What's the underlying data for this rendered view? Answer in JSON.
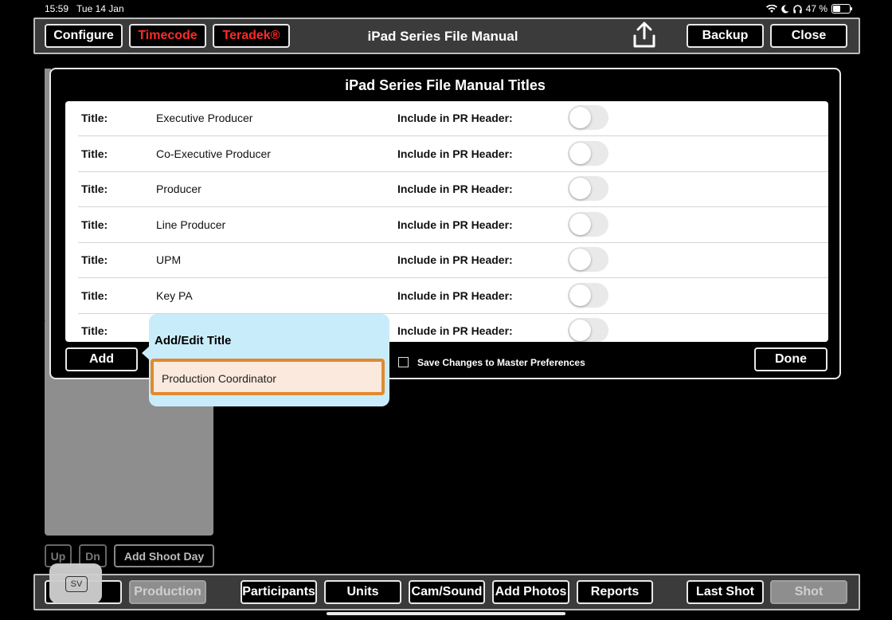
{
  "status": {
    "time": "15:59",
    "date": "Tue 14 Jan",
    "battery": "47 %"
  },
  "topbar": {
    "configure": "Configure",
    "timecode": "Timecode",
    "teradek": "Teradek®",
    "title": "iPad Series File Manual",
    "backup": "Backup",
    "close": "Close"
  },
  "modal": {
    "title": "iPad Series File Manual Titles",
    "rows": [
      {
        "label": "Title:",
        "value": "Executive Producer",
        "include_label": "Include in PR Header:",
        "include": false
      },
      {
        "label": "Title:",
        "value": "Co-Executive Producer",
        "include_label": "Include in PR Header:",
        "include": false
      },
      {
        "label": "Title:",
        "value": "Producer",
        "include_label": "Include in PR Header:",
        "include": false
      },
      {
        "label": "Title:",
        "value": "Line Producer",
        "include_label": "Include in PR Header:",
        "include": false
      },
      {
        "label": "Title:",
        "value": "UPM",
        "include_label": "Include in PR Header:",
        "include": false
      },
      {
        "label": "Title:",
        "value": "Key PA",
        "include_label": "Include in PR Header:",
        "include": false
      },
      {
        "label": "Title:",
        "value": "",
        "include_label": "Include in PR Header:",
        "include": false
      }
    ],
    "add": "Add",
    "save_master": "Save Changes to Master Preferences",
    "done": "Done"
  },
  "popover": {
    "title": "Add/Edit Title",
    "input_value": "Production Coordinator"
  },
  "lower": {
    "up": "Up",
    "dn": "Dn",
    "add_shoot_day": "Add Shoot Day"
  },
  "bottombar": {
    "sv": "SV",
    "production": "Production",
    "participants": "Participants",
    "units": "Units",
    "cam_sound": "Cam/Sound",
    "add_photos": "Add Photos",
    "reports": "Reports",
    "last_shot": "Last Shot",
    "shot": "Shot"
  },
  "colors": {
    "accent_red": "#ff2a2a",
    "popover_bg": "#c9ecfb",
    "field_border": "#e08a2f"
  }
}
